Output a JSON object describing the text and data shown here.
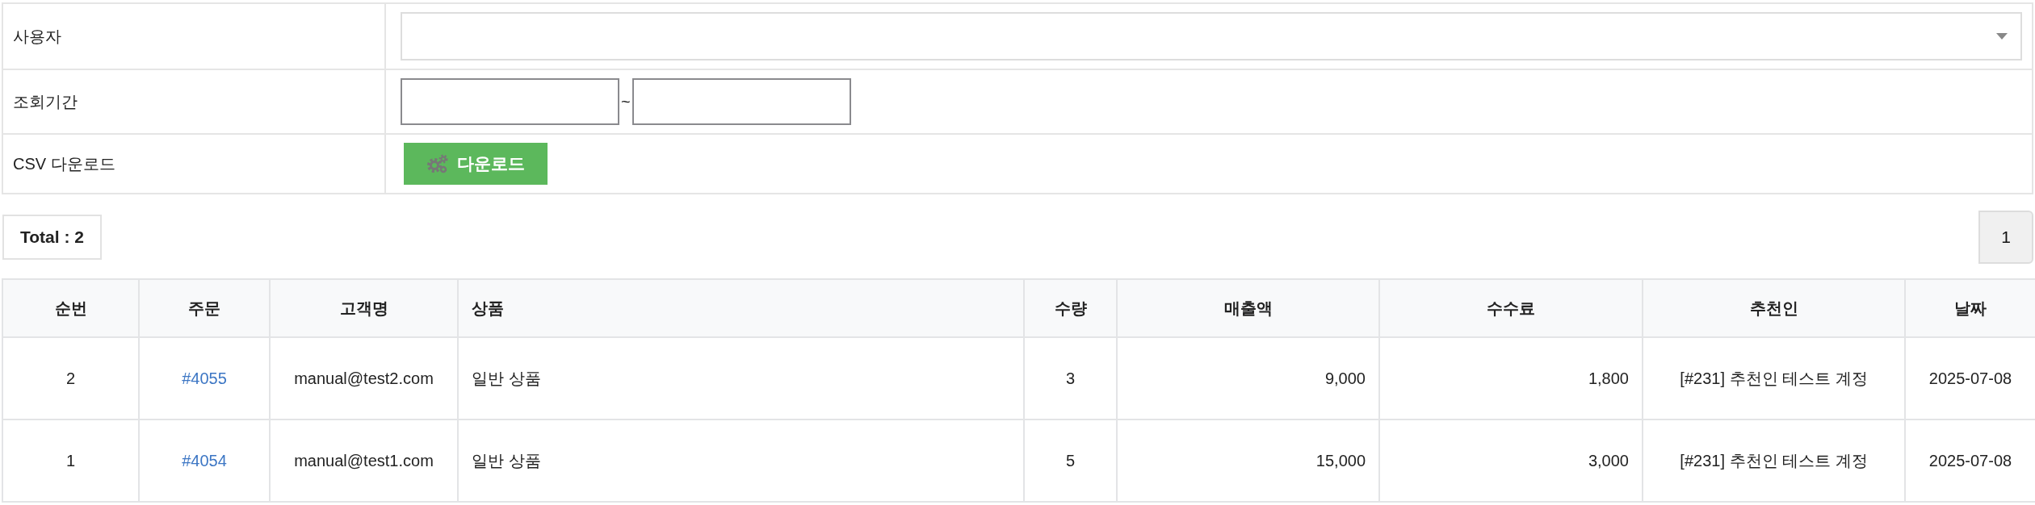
{
  "filters": [
    {
      "label": "사용자",
      "kind": "select"
    },
    {
      "label": "조회기간",
      "kind": "date_range",
      "separator": "~"
    },
    {
      "label": "CSV 다운로드",
      "kind": "button",
      "button": "다운로드"
    }
  ],
  "total": "Total : 2",
  "pages": [
    "1"
  ],
  "table": {
    "columns": [
      "순번",
      "주문",
      "고객명",
      "상품",
      "수량",
      "매출액",
      "수수료",
      "추천인",
      "날짜"
    ],
    "rows": [
      [
        "2",
        "#4055",
        "manual@test2.com",
        "일반 상품",
        "3",
        "9,000",
        "1,800",
        "[#231] 추천인 테스트 계정",
        "2025-07-08"
      ],
      [
        "1",
        "#4054",
        "manual@test1.com",
        "일반 상품",
        "5",
        "15,000",
        "3,000",
        "[#231] 추천인 테스트 계정",
        "2025-07-08"
      ]
    ]
  }
}
